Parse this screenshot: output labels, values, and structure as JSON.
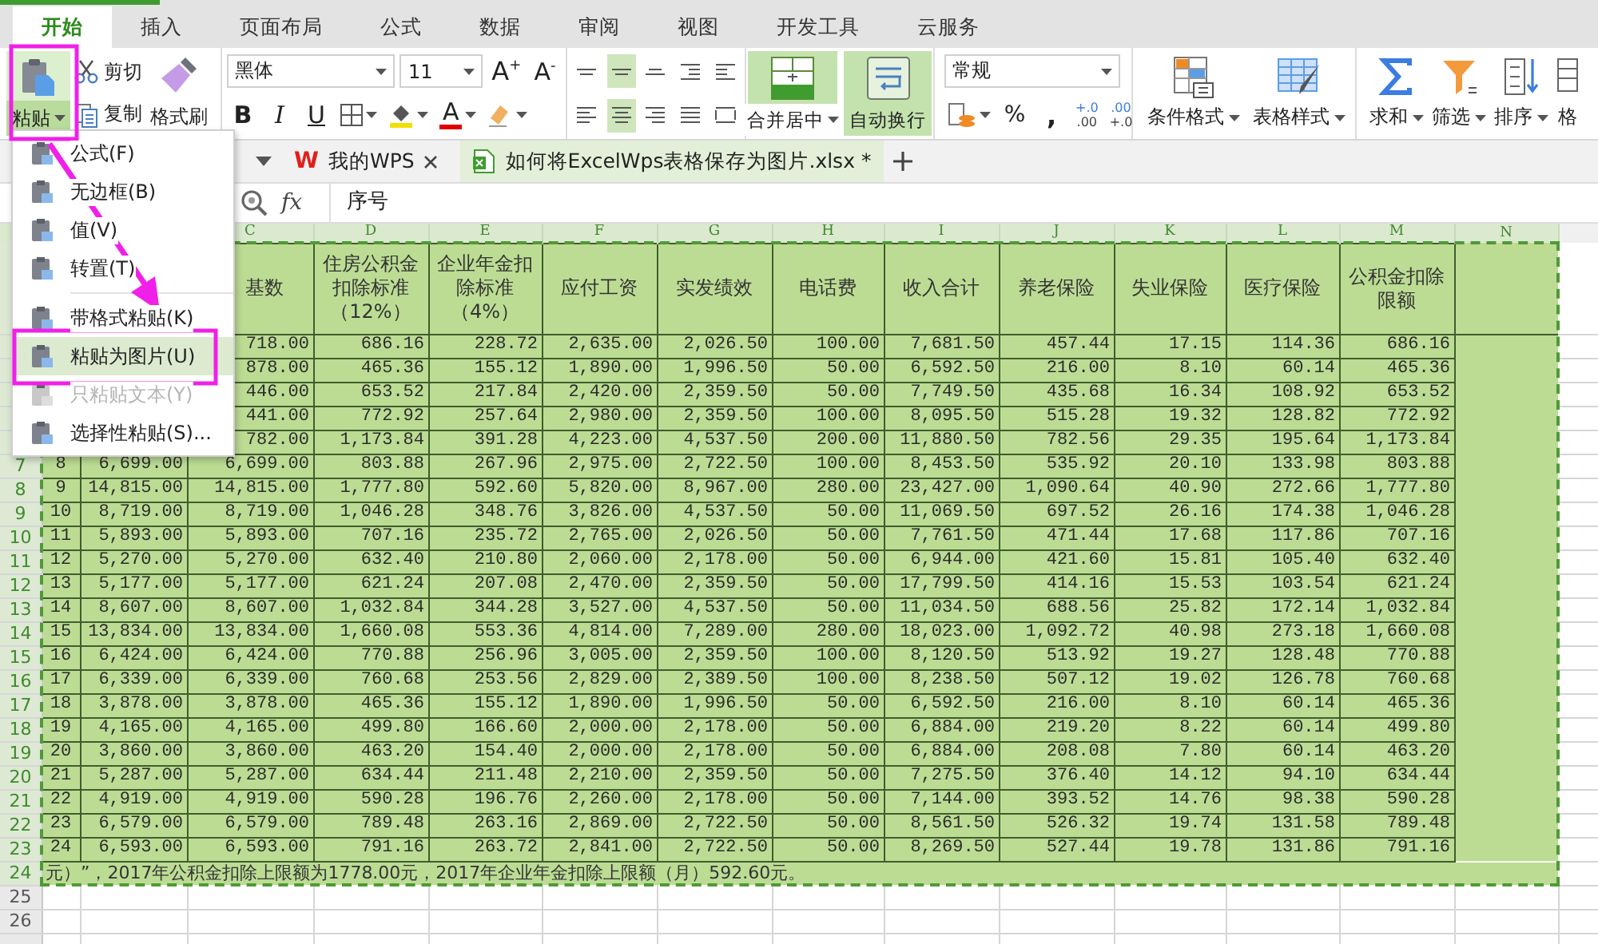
{
  "app_tabs": [
    {
      "label": "开始",
      "selected": true
    },
    {
      "label": "插入",
      "selected": false
    },
    {
      "label": "页面布局",
      "selected": false
    },
    {
      "label": "公式",
      "selected": false
    },
    {
      "label": "数据",
      "selected": false
    },
    {
      "label": "审阅",
      "selected": false
    },
    {
      "label": "视图",
      "selected": false
    },
    {
      "label": "开发工具",
      "selected": false
    },
    {
      "label": "云服务",
      "selected": false
    }
  ],
  "ribbon": {
    "paste": {
      "label": "粘贴",
      "selected": true
    },
    "cut": "剪切",
    "copy": "复制",
    "format_painter": "格式刷",
    "font_name": "黑体",
    "font_size": "11",
    "grow_font": "A$^{+}$",
    "shrink_font": "A$^{-}$",
    "style_buttons": [
      "B",
      "I",
      "U"
    ],
    "font_color": "A",
    "align_buttons": [
      {
        "kind": "top",
        "selected": false
      },
      {
        "kind": "middle",
        "selected": true
      },
      {
        "kind": "bottom",
        "selected": false
      },
      {
        "kind": "outdent",
        "selected": false
      },
      {
        "kind": "indent",
        "selected": false
      },
      {
        "kind": "left",
        "selected": false
      },
      {
        "kind": "center",
        "selected": true
      },
      {
        "kind": "right",
        "selected": false
      },
      {
        "kind": "justify",
        "selected": false
      },
      {
        "kind": "distributed",
        "selected": false
      }
    ],
    "merge": {
      "label": "合并居中",
      "selected": true
    },
    "wrap": {
      "label": "自动换行",
      "selected": true
    },
    "number_format": "常规",
    "percent": "%",
    "comma": ",",
    "decimal_buttons": [
      {
        "top": "+.0",
        "bottom": ".00"
      },
      {
        "top": ".00",
        "bottom": "+.0"
      }
    ],
    "style_gallery": [
      {
        "kind": "conditional",
        "label": "条件格式"
      },
      {
        "kind": "table",
        "label": "表格样式"
      }
    ],
    "edit_buttons": [
      {
        "kind": "sum",
        "label": "求和"
      },
      {
        "kind": "filter",
        "label": "筛选"
      },
      {
        "kind": "sort",
        "label": "排序"
      },
      {
        "kind": "format",
        "label": "格"
      }
    ]
  },
  "doc_tabs": [
    {
      "kind": "home",
      "icon_text": "W",
      "label": "我的WPS",
      "selected": false
    },
    {
      "kind": "file",
      "label": "如何将ExcelWps表格保存为图片.xlsx *",
      "selected": true
    }
  ],
  "formula_bar": {
    "function_label": "fx",
    "value": "序号"
  },
  "paste_menu": {
    "groups": [
      [
        {
          "label": "公式(F)",
          "selected": false,
          "disabled": false
        },
        {
          "label": "无边框(B)",
          "selected": false,
          "disabled": false
        },
        {
          "label": "值(V)",
          "selected": false,
          "disabled": false
        },
        {
          "label": "转置(T)",
          "selected": false,
          "disabled": false
        }
      ],
      [
        {
          "label": "带格式粘贴(K)",
          "selected": false,
          "disabled": false
        },
        {
          "label": "粘贴为图片(U)",
          "selected": true,
          "disabled": false
        },
        {
          "label": "只粘贴文本(Y)",
          "selected": false,
          "disabled": true
        },
        {
          "label": "选择性粘贴(S)...",
          "selected": false,
          "disabled": false
        }
      ]
    ]
  },
  "sheet": {
    "column_letters": [
      "C",
      "D",
      "E",
      "F",
      "G",
      "H",
      "I",
      "J",
      "K",
      "L",
      "M",
      "N"
    ],
    "header": {
      "cells": [
        "基数",
        "住房公积金扣除标准（12%）",
        "企业年金扣除标准（4%）",
        "应付工资",
        "实发绩效",
        "电话费",
        "收入合计",
        "养老保险",
        "失业保险",
        "医疗保险",
        "公积金扣除限额"
      ]
    },
    "rows": [
      {
        "cells": [
          "718.00",
          "686.16",
          "228.72",
          "2,635.00",
          "2,026.50",
          "100.00",
          "7,681.50",
          "457.44",
          "17.15",
          "114.36",
          "686.16"
        ]
      },
      {
        "cells": [
          "878.00",
          "465.36",
          "155.12",
          "1,890.00",
          "1,996.50",
          "50.00",
          "6,592.50",
          "216.00",
          "8.10",
          "60.14",
          "465.36"
        ]
      },
      {
        "cells": [
          "446.00",
          "653.52",
          "217.84",
          "2,420.00",
          "2,359.50",
          "50.00",
          "7,749.50",
          "435.68",
          "16.34",
          "108.92",
          "653.52"
        ]
      },
      {
        "cells": [
          "441.00",
          "772.92",
          "257.64",
          "2,980.00",
          "2,359.50",
          "100.00",
          "8,095.50",
          "515.28",
          "19.32",
          "128.82",
          "772.92"
        ]
      },
      {
        "cells": [
          "782.00",
          "1,173.84",
          "391.28",
          "4,223.00",
          "4,537.50",
          "200.00",
          "11,880.50",
          "782.56",
          "29.35",
          "195.64",
          "1,173.84"
        ]
      },
      {
        "number": "7",
        "cells": [
          "8",
          "6,699.00",
          "6,699.00",
          "803.88",
          "267.96",
          "2,975.00",
          "2,722.50",
          "100.00",
          "8,453.50",
          "535.92",
          "20.10",
          "133.98",
          "803.88"
        ]
      },
      {
        "number": "8",
        "cells": [
          "9",
          "14,815.00",
          "14,815.00",
          "1,777.80",
          "592.60",
          "5,820.00",
          "8,967.00",
          "280.00",
          "23,427.00",
          "1,090.64",
          "40.90",
          "272.66",
          "1,777.80"
        ]
      },
      {
        "number": "9",
        "cells": [
          "10",
          "8,719.00",
          "8,719.00",
          "1,046.28",
          "348.76",
          "3,826.00",
          "4,537.50",
          "50.00",
          "11,069.50",
          "697.52",
          "26.16",
          "174.38",
          "1,046.28"
        ]
      },
      {
        "number": "10",
        "cells": [
          "11",
          "5,893.00",
          "5,893.00",
          "707.16",
          "235.72",
          "2,765.00",
          "2,026.50",
          "50.00",
          "7,761.50",
          "471.44",
          "17.68",
          "117.86",
          "707.16"
        ]
      },
      {
        "number": "11",
        "cells": [
          "12",
          "5,270.00",
          "5,270.00",
          "632.40",
          "210.80",
          "2,060.00",
          "2,178.00",
          "50.00",
          "6,944.00",
          "421.60",
          "15.81",
          "105.40",
          "632.40"
        ]
      },
      {
        "number": "12",
        "cells": [
          "13",
          "5,177.00",
          "5,177.00",
          "621.24",
          "207.08",
          "2,470.00",
          "2,359.50",
          "50.00",
          "17,799.50",
          "414.16",
          "15.53",
          "103.54",
          "621.24"
        ]
      },
      {
        "number": "13",
        "cells": [
          "14",
          "8,607.00",
          "8,607.00",
          "1,032.84",
          "344.28",
          "3,527.00",
          "4,537.50",
          "50.00",
          "11,034.50",
          "688.56",
          "25.82",
          "172.14",
          "1,032.84"
        ]
      },
      {
        "number": "14",
        "cells": [
          "15",
          "13,834.00",
          "13,834.00",
          "1,660.08",
          "553.36",
          "4,814.00",
          "7,289.00",
          "280.00",
          "18,023.00",
          "1,092.72",
          "40.98",
          "273.18",
          "1,660.08"
        ]
      },
      {
        "number": "15",
        "cells": [
          "16",
          "6,424.00",
          "6,424.00",
          "770.88",
          "256.96",
          "3,005.00",
          "2,359.50",
          "100.00",
          "8,120.50",
          "513.92",
          "19.27",
          "128.48",
          "770.88"
        ]
      },
      {
        "number": "16",
        "cells": [
          "17",
          "6,339.00",
          "6,339.00",
          "760.68",
          "253.56",
          "2,829.00",
          "2,389.50",
          "100.00",
          "8,238.50",
          "507.12",
          "19.02",
          "126.78",
          "760.68"
        ]
      },
      {
        "number": "17",
        "cells": [
          "18",
          "3,878.00",
          "3,878.00",
          "465.36",
          "155.12",
          "1,890.00",
          "1,996.50",
          "50.00",
          "6,592.50",
          "216.00",
          "8.10",
          "60.14",
          "465.36"
        ]
      },
      {
        "number": "18",
        "cells": [
          "19",
          "4,165.00",
          "4,165.00",
          "499.80",
          "166.60",
          "2,000.00",
          "2,178.00",
          "50.00",
          "6,884.00",
          "219.20",
          "8.22",
          "60.14",
          "499.80"
        ]
      },
      {
        "number": "19",
        "cells": [
          "20",
          "3,860.00",
          "3,860.00",
          "463.20",
          "154.40",
          "2,000.00",
          "2,178.00",
          "50.00",
          "6,884.00",
          "208.08",
          "7.80",
          "60.14",
          "463.20"
        ]
      },
      {
        "number": "20",
        "cells": [
          "21",
          "5,287.00",
          "5,287.00",
          "634.44",
          "211.48",
          "2,210.00",
          "2,359.50",
          "50.00",
          "7,275.50",
          "376.40",
          "14.12",
          "94.10",
          "634.44"
        ]
      },
      {
        "number": "21",
        "cells": [
          "22",
          "4,919.00",
          "4,919.00",
          "590.28",
          "196.76",
          "2,260.00",
          "2,178.00",
          "50.00",
          "7,144.00",
          "393.52",
          "14.76",
          "98.38",
          "590.28"
        ]
      },
      {
        "number": "22",
        "cells": [
          "23",
          "6,579.00",
          "6,579.00",
          "789.48",
          "263.16",
          "2,869.00",
          "2,722.50",
          "50.00",
          "8,561.50",
          "526.32",
          "19.74",
          "131.58",
          "789.48"
        ]
      },
      {
        "number": "23",
        "cells": [
          "24",
          "6,593.00",
          "6,593.00",
          "791.16",
          "263.72",
          "2,841.00",
          "2,722.50",
          "50.00",
          "8,269.50",
          "527.44",
          "19.78",
          "131.86",
          "791.16"
        ]
      }
    ],
    "note": {
      "number": "24",
      "text": "元）”，2017年公积金扣除上限额为1778.00元，2017年企业年金扣除上限额（月）592.60元。"
    },
    "empty_rows": [
      "25",
      "26"
    ]
  }
}
